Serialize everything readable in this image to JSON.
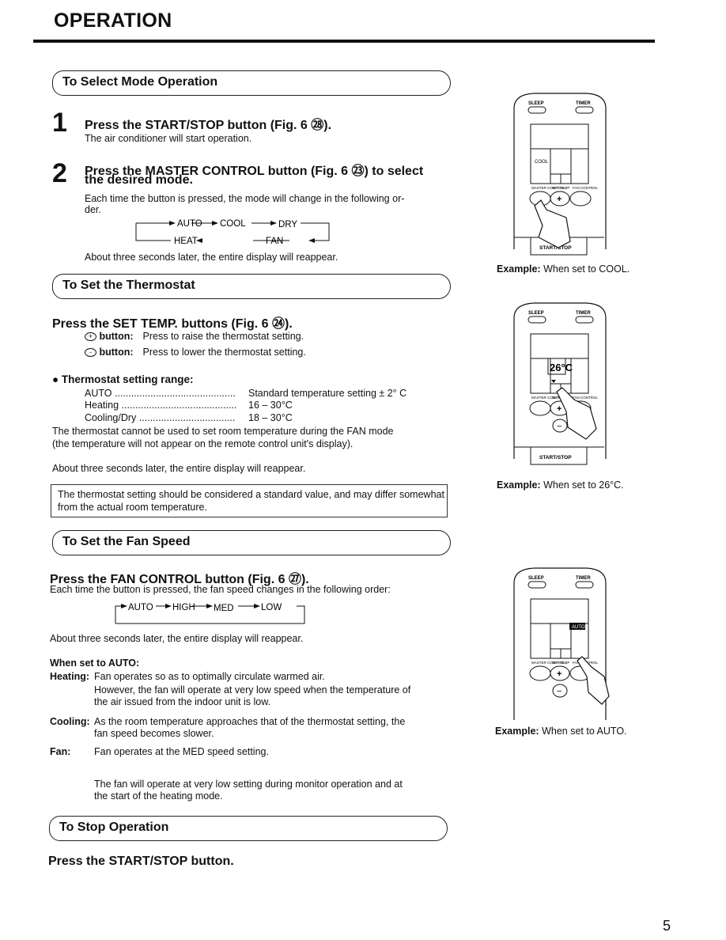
{
  "title": "OPERATION",
  "sections": [
    {
      "header": "To Select Mode Operation",
      "step1": {
        "number": "1",
        "heading": "Press the START/STOP button (Fig. 6 ㉘).",
        "text": "The air conditioner will start operation."
      },
      "step2": {
        "number": "2",
        "heading_line1": "Press the MASTER CONTROL button (Fig. 6 ㉓) to select",
        "heading_line2": "the desired mode.",
        "text_line1": "Each time the button is pressed, the mode will change in the following or-",
        "text_line2": "der.",
        "cycle": [
          "AUTO",
          "COOL",
          "DRY",
          "FAN",
          "HEAT"
        ]
      },
      "after": "About three seconds later, the entire display will reappear."
    },
    {
      "header": "To Set the Thermostat",
      "heading": "Press the SET TEMP. buttons (Fig. 6 ㉔).",
      "buttons": [
        {
          "label": "button:",
          "text": "Press to raise the thermostat setting."
        },
        {
          "label": "button:",
          "text": "Press to lower the thermostat setting."
        }
      ],
      "range_title": "Thermostat setting range:",
      "ranges": [
        {
          "mode": "AUTO",
          "dots": "............................................",
          "value": "Standard temperature setting ± 2° C"
        },
        {
          "mode": "Heating",
          "dots": "..........................................",
          "value": "16 – 30°C"
        },
        {
          "mode": "Cooling/Dry",
          "dots": "...................................",
          "value": "18 – 30°C"
        }
      ],
      "para_line1": "The thermostat cannot be used to set room temperature during the FAN mode",
      "para_line2": "(the temperature will not appear on the remote control unit's display).",
      "after": "About three seconds later, the entire display will reappear.",
      "note": "The thermostat setting should be considered a standard value, and may differ somewhat from the actual room temperature."
    },
    {
      "header": "To Set the Fan Speed",
      "heading": "Press the FAN CONTROL button (Fig. 6 ㉗).",
      "text": "Each time the button is pressed, the fan speed changes in the following order:",
      "cycle": [
        "AUTO",
        "HIGH",
        "MED",
        "LOW"
      ],
      "after": "About three seconds later, the entire display will reappear.",
      "auto_title": "When set to AUTO:",
      "items": [
        {
          "label": "Heating:",
          "line1": "Fan operates so as to optimally circulate warmed air.",
          "line2": "However, the fan will operate at very low speed when the temperature of",
          "line3": "the air issued from the indoor unit is low."
        },
        {
          "label": "Cooling:",
          "line1": "As the room temperature approaches that of the thermostat setting, the",
          "line2": "fan speed becomes slower."
        },
        {
          "label": "Fan:",
          "line1": "Fan operates at the MED speed setting."
        }
      ],
      "note_line1": "The fan will operate at very low setting during monitor operation and at",
      "note_line2": "the start of the heating mode."
    },
    {
      "header": "To Stop Operation",
      "heading": "Press the START/STOP button."
    }
  ],
  "remote": {
    "sleep": "SLEEP",
    "timer": "TIMER",
    "master": "MASTER CONTROL",
    "settemp": "SET TEMP",
    "settime": "SET TIME",
    "fan": "FAN CONTROL",
    "startstop": "START/STOP",
    "plus": "+",
    "minus": "−"
  },
  "figures": [
    {
      "display": "COOL",
      "caption_bold": "Example:",
      "caption": " When set to COOL."
    },
    {
      "display": "26°C",
      "caption_bold": "Example:",
      "caption": " When set to 26°C."
    },
    {
      "display": "AUTO",
      "caption_bold": "Example:",
      "caption": " When set to AUTO."
    }
  ],
  "page_number": "5"
}
